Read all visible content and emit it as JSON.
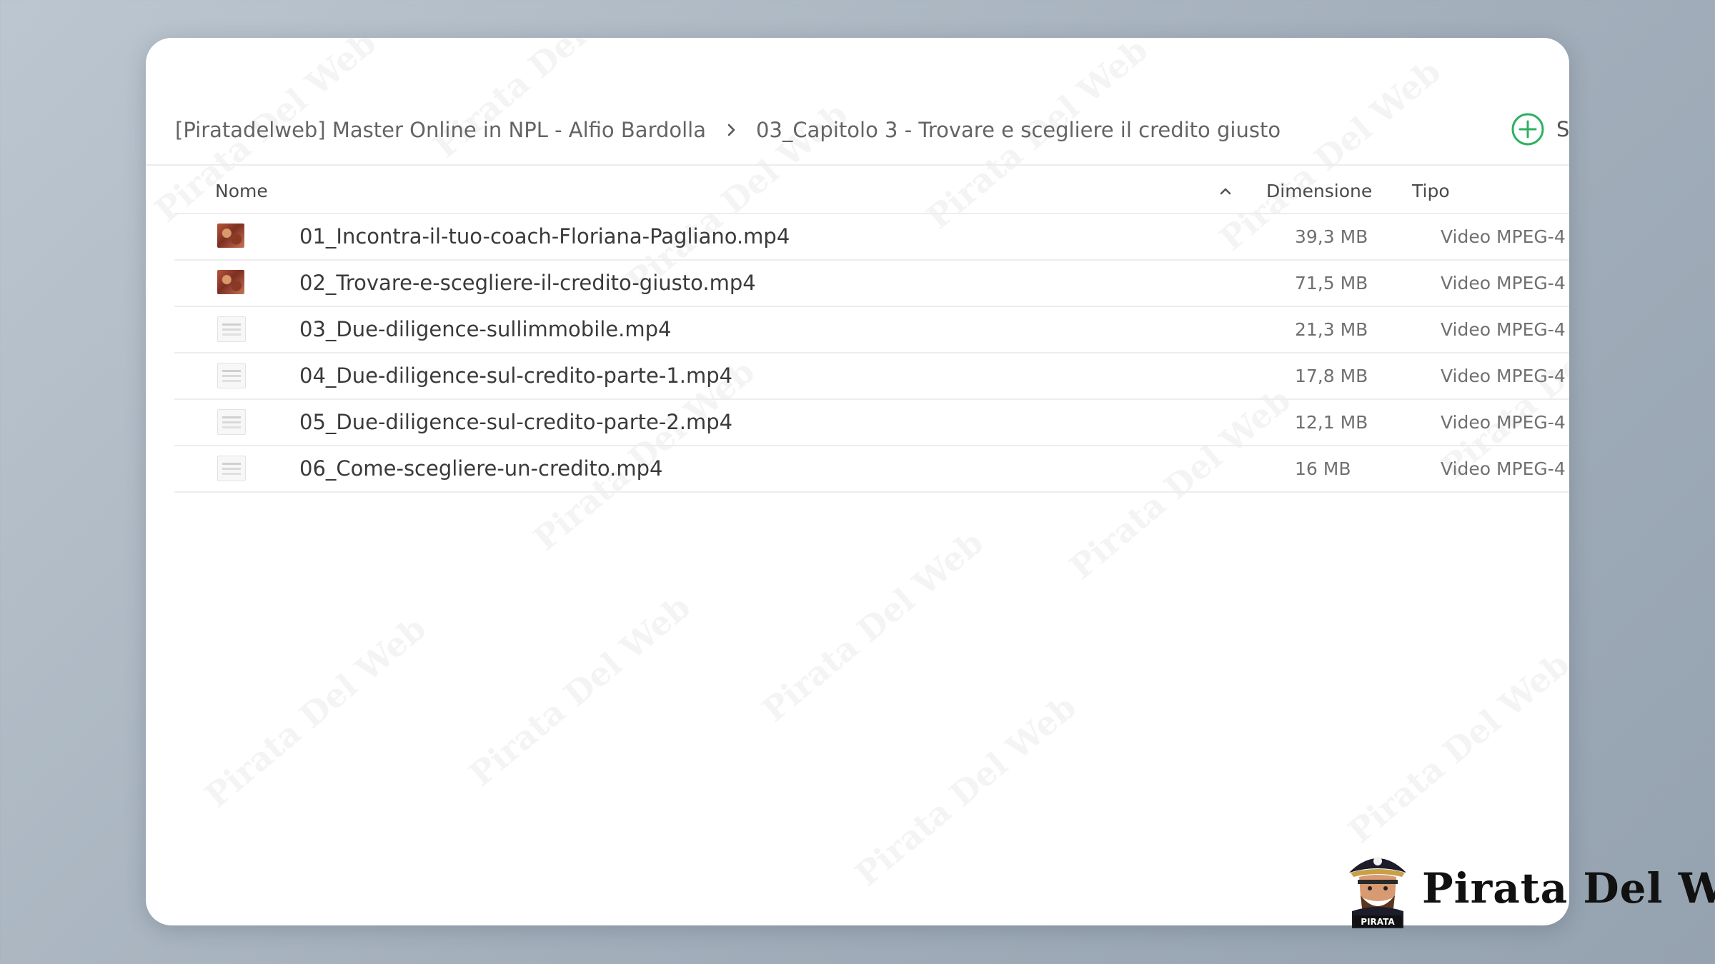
{
  "breadcrumb": {
    "items": [
      {
        "label": "[Piratadelweb] Master Online in NPL - Alfio Bardolla"
      },
      {
        "label": "03_Capitolo 3 - Trovare e scegliere il credito giusto"
      }
    ]
  },
  "toolbar": {
    "new_label": "S",
    "accent_color": "#2eb160"
  },
  "table": {
    "columns": {
      "name": "Nome",
      "size": "Dimensione",
      "type": "Tipo"
    },
    "sort": {
      "column": "name",
      "direction": "ascending",
      "icon": "chevron-up-icon"
    },
    "rows": [
      {
        "name": "01_Incontra-il-tuo-coach-Floriana-Pagliano.mp4",
        "size": "39,3 MB",
        "type": "Video MPEG-4",
        "thumb": "photo"
      },
      {
        "name": "02_Trovare-e-scegliere-il-credito-giusto.mp4",
        "size": "71,5 MB",
        "type": "Video MPEG-4",
        "thumb": "photo"
      },
      {
        "name": "03_Due-diligence-sullimmobile.mp4",
        "size": "21,3 MB",
        "type": "Video MPEG-4",
        "thumb": "slide"
      },
      {
        "name": "04_Due-diligence-sul-credito-parte-1.mp4",
        "size": "17,8 MB",
        "type": "Video MPEG-4",
        "thumb": "slide"
      },
      {
        "name": "05_Due-diligence-sul-credito-parte-2.mp4",
        "size": "12,1 MB",
        "type": "Video MPEG-4",
        "thumb": "slide"
      },
      {
        "name": "06_Come-scegliere-un-credito.mp4",
        "size": "16 MB",
        "type": "Video MPEG-4",
        "thumb": "slide"
      }
    ]
  },
  "watermark": {
    "text": "Pirata Del Web"
  },
  "brand": {
    "name": "Pirata Del Web",
    "badge": "PIRATA"
  }
}
